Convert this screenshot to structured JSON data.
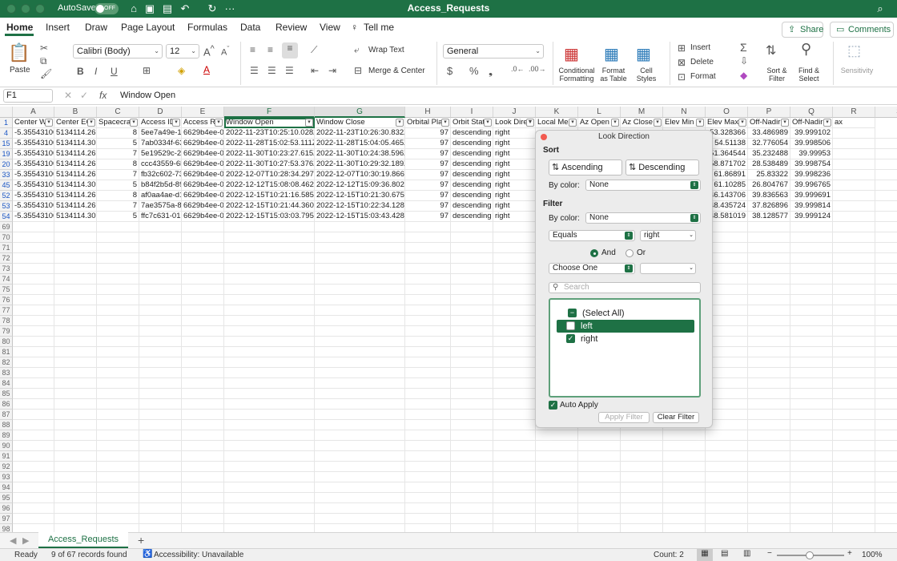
{
  "titlebar": {
    "autosave_label": "AutoSave",
    "autosave_state": "OFF",
    "doc_title": "Access_Requests"
  },
  "tabs": [
    "Home",
    "Insert",
    "Draw",
    "Page Layout",
    "Formulas",
    "Data",
    "Review",
    "View"
  ],
  "tell_me": "Tell me",
  "share_label": "Share",
  "comments_label": "Comments",
  "ribbon": {
    "paste": "Paste",
    "font_name": "Calibri (Body)",
    "font_size": "12",
    "wrap_text": "Wrap Text",
    "merge_center": "Merge & Center",
    "number_format": "General",
    "conditional_formatting": [
      "Conditional",
      "Formatting"
    ],
    "format_as_table": [
      "Format",
      "as Table"
    ],
    "cell_styles": [
      "Cell",
      "Styles"
    ],
    "insert": "Insert",
    "delete": "Delete",
    "format": "Format",
    "sort_filter": [
      "Sort &",
      "Filter"
    ],
    "find_select": [
      "Find &",
      "Select"
    ],
    "sensitivity": "Sensitivity"
  },
  "formula_bar": {
    "name_box": "F1",
    "fx": "fx",
    "content": "Window Open"
  },
  "columns": [
    "A",
    "B",
    "C",
    "D",
    "E",
    "F",
    "G",
    "H",
    "I",
    "J",
    "K",
    "L",
    "M",
    "N",
    "O",
    "P",
    "Q",
    "R",
    "S"
  ],
  "headers": [
    "Center W",
    "Center EC",
    "Spacecraf",
    "Access ID",
    "Access Re",
    "Window Open",
    "Window Close",
    "Orbital Pla",
    "Orbit Stat",
    "Look Direc",
    "Local Me",
    "Az Open",
    "Az Close",
    "Elev Min",
    "Elev Max",
    "Off-Nadir",
    "Off-Nadir",
    "ax"
  ],
  "rows": [
    {
      "row": "4",
      "cells": [
        "-5.35543100",
        "5134114.267",
        "8",
        "5ee7a49e-17",
        "6629b4ee-02",
        "2022-11-23T10:25:10.028Z",
        "2022-11-23T10:26:30.832Z",
        "97",
        "descending",
        "right",
        "",
        "",
        "",
        "",
        "53.328366",
        "33.486989",
        "39.999102"
      ]
    },
    {
      "row": "15",
      "cells": [
        "-5.35543100",
        "5134114.307",
        "5",
        "7ab0334f-63",
        "6629b4ee-02",
        "2022-11-28T15:02:53.111Z",
        "2022-11-28T15:04:05.465Z",
        "97",
        "descending",
        "right",
        "",
        "",
        "",
        "",
        "54.51138",
        "32.776054",
        "39.998506"
      ]
    },
    {
      "row": "19",
      "cells": [
        "-5.35543100",
        "5134114.266",
        "7",
        "5e19529c-2e",
        "6629b4ee-02",
        "2022-11-30T10:23:27.615Z",
        "2022-11-30T10:24:38.596Z",
        "97",
        "descending",
        "right",
        "",
        "",
        "",
        "",
        "51.364544",
        "35.232488",
        "39.99953"
      ]
    },
    {
      "row": "20",
      "cells": [
        "-5.35543100",
        "5134114.267",
        "8",
        "ccc43559-6b",
        "6629b4ee-02",
        "2022-11-30T10:27:53.376Z",
        "2022-11-30T10:29:32.189Z",
        "97",
        "descending",
        "right",
        "",
        "",
        "",
        "",
        "58.871702",
        "28.538489",
        "39.998754"
      ]
    },
    {
      "row": "33",
      "cells": [
        "-5.35543100",
        "5134114.266",
        "7",
        "fb32c602-73",
        "6629b4ee-02",
        "2022-12-07T10:28:34.297Z",
        "2022-12-07T10:30:19.866Z",
        "97",
        "descending",
        "right",
        "",
        "",
        "",
        "",
        "61.86891",
        "25.83322",
        "39.998236"
      ]
    },
    {
      "row": "45",
      "cells": [
        "-5.35543100",
        "5134114.307",
        "5",
        "b84f2b5d-89",
        "6629b4ee-02",
        "2022-12-12T15:08:08.462Z",
        "2022-12-12T15:09:36.802Z",
        "97",
        "descending",
        "right",
        "",
        "",
        "",
        "",
        "61.10285",
        "26.804767",
        "39.996765"
      ]
    },
    {
      "row": "52",
      "cells": [
        "-5.35543100",
        "5134114.267",
        "8",
        "af0aa4ae-d1",
        "6629b4ee-02",
        "2022-12-15T10:21:16.585Z",
        "2022-12-15T10:21:30.675Z",
        "97",
        "descending",
        "right",
        "",
        "",
        "",
        "",
        "46.143706",
        "39.836563",
        "39.999691"
      ]
    },
    {
      "row": "53",
      "cells": [
        "-5.35543100",
        "5134114.266",
        "7",
        "7ae3575a-84",
        "6629b4ee-02",
        "2022-12-15T10:21:44.360Z",
        "2022-12-15T10:22:34.128Z",
        "97",
        "descending",
        "right",
        "",
        "",
        "",
        "",
        "48.435724",
        "37.826896",
        "39.999814"
      ]
    },
    {
      "row": "54",
      "cells": [
        "-5.35543100",
        "5134114.307",
        "5",
        "ffc7c631-01",
        "6629b4ee-02",
        "2022-12-15T15:03:03.795Z",
        "2022-12-15T15:03:43.428Z",
        "97",
        "descending",
        "right",
        "",
        "",
        "",
        "",
        "48.581019",
        "38.128577",
        "39.999124"
      ]
    }
  ],
  "empty_rows": [
    "69",
    "70",
    "71",
    "72",
    "73",
    "74",
    "75",
    "76",
    "77",
    "78",
    "79",
    "80",
    "81",
    "82",
    "83",
    "84",
    "85",
    "86",
    "87",
    "88",
    "89",
    "90",
    "91",
    "92",
    "93",
    "94",
    "95",
    "96",
    "97",
    "98"
  ],
  "popup": {
    "title": "Look Direction",
    "sort_label": "Sort",
    "ascending": "Ascending",
    "descending": "Descending",
    "by_color": "By color:",
    "sort_color_value": "None",
    "filter_label": "Filter",
    "filter_color_value": "None",
    "condition1": "Equals",
    "value1": "right",
    "and_label": "And",
    "or_label": "Or",
    "condition2": "Choose One",
    "value2": "",
    "search_placeholder": "Search",
    "items": [
      {
        "label": "(Select All)",
        "state": "mixed"
      },
      {
        "label": "left",
        "state": "unchecked"
      },
      {
        "label": "right",
        "state": "checked"
      }
    ],
    "auto_apply": "Auto Apply",
    "apply_filter": "Apply Filter",
    "clear_filter": "Clear Filter"
  },
  "sheet_tab": "Access_Requests",
  "status": {
    "ready": "Ready",
    "records": "9 of 67 records found",
    "accessibility": "Accessibility: Unavailable",
    "count": "Count: 2",
    "zoom": "100%"
  },
  "colors": {
    "accent": "#1e7145",
    "row_blue": "#1a56c4"
  }
}
